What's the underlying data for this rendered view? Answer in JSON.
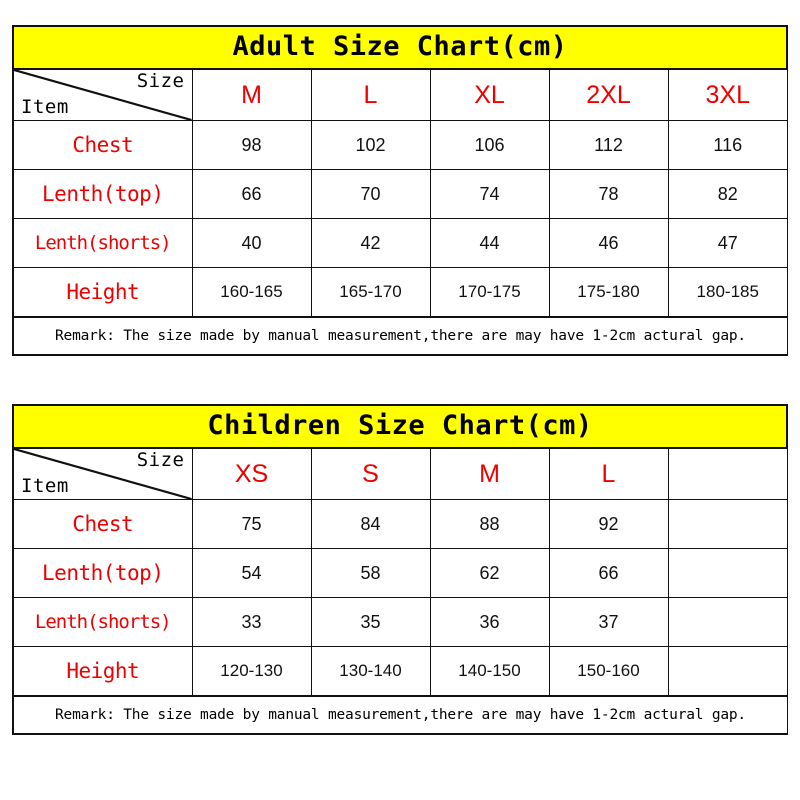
{
  "charts": [
    {
      "id": "adult",
      "title": "Adult Size Chart(cm)",
      "corner": {
        "size_label": "Size",
        "item_label": "Item"
      },
      "sizes": [
        "M",
        "L",
        "XL",
        "2XL",
        "3XL"
      ],
      "rows": [
        {
          "label": "Chest",
          "values": [
            "98",
            "102",
            "106",
            "112",
            "116"
          ]
        },
        {
          "label": "Lenth(top)",
          "values": [
            "66",
            "70",
            "74",
            "78",
            "82"
          ]
        },
        {
          "label": "Lenth(shorts)",
          "values": [
            "40",
            "42",
            "44",
            "46",
            "47"
          ]
        },
        {
          "label": "Height",
          "values": [
            "160-165",
            "165-170",
            "170-175",
            "175-180",
            "180-185"
          ]
        }
      ],
      "remark": "Remark: The size made by manual measurement,there are may have 1-2cm actural gap."
    },
    {
      "id": "children",
      "title": "Children Size Chart(cm)",
      "corner": {
        "size_label": "Size",
        "item_label": "Item"
      },
      "sizes": [
        "XS",
        "S",
        "M",
        "L",
        ""
      ],
      "rows": [
        {
          "label": "Chest",
          "values": [
            "75",
            "84",
            "88",
            "92",
            ""
          ]
        },
        {
          "label": "Lenth(top)",
          "values": [
            "54",
            "58",
            "62",
            "66",
            ""
          ]
        },
        {
          "label": "Lenth(shorts)",
          "values": [
            "33",
            "35",
            "36",
            "37",
            ""
          ]
        },
        {
          "label": "Height",
          "values": [
            "120-130",
            "130-140",
            "140-150",
            "150-160",
            ""
          ]
        }
      ],
      "remark": "Remark: The size made by manual measurement,there are may have 1-2cm actural gap."
    }
  ],
  "colors": {
    "title_background": "#ffff00",
    "accent_red": "#ee0000",
    "border": "#111111",
    "text": "#000000",
    "page_background": "#ffffff"
  },
  "chart_data": {
    "type": "table",
    "title": "Adult & Children Size Charts (cm)",
    "tables": [
      {
        "title": "Adult Size Chart(cm)",
        "columns": [
          "Item \\ Size",
          "M",
          "L",
          "XL",
          "2XL",
          "3XL"
        ],
        "rows": [
          [
            "Chest",
            98,
            102,
            106,
            112,
            116
          ],
          [
            "Lenth(top)",
            66,
            70,
            74,
            78,
            82
          ],
          [
            "Lenth(shorts)",
            40,
            42,
            44,
            46,
            47
          ],
          [
            "Height",
            "160-165",
            "165-170",
            "170-175",
            "175-180",
            "180-185"
          ]
        ],
        "note": "Remark: The size made by manual measurement,there are may have 1-2cm actural gap."
      },
      {
        "title": "Children Size Chart(cm)",
        "columns": [
          "Item \\ Size",
          "XS",
          "S",
          "M",
          "L",
          ""
        ],
        "rows": [
          [
            "Chest",
            75,
            84,
            88,
            92,
            ""
          ],
          [
            "Lenth(top)",
            54,
            58,
            62,
            66,
            ""
          ],
          [
            "Lenth(shorts)",
            33,
            35,
            36,
            37,
            ""
          ],
          [
            "Height",
            "120-130",
            "130-140",
            "140-150",
            "150-160",
            ""
          ]
        ],
        "note": "Remark: The size made by manual measurement,there are may have 1-2cm actural gap."
      }
    ]
  }
}
